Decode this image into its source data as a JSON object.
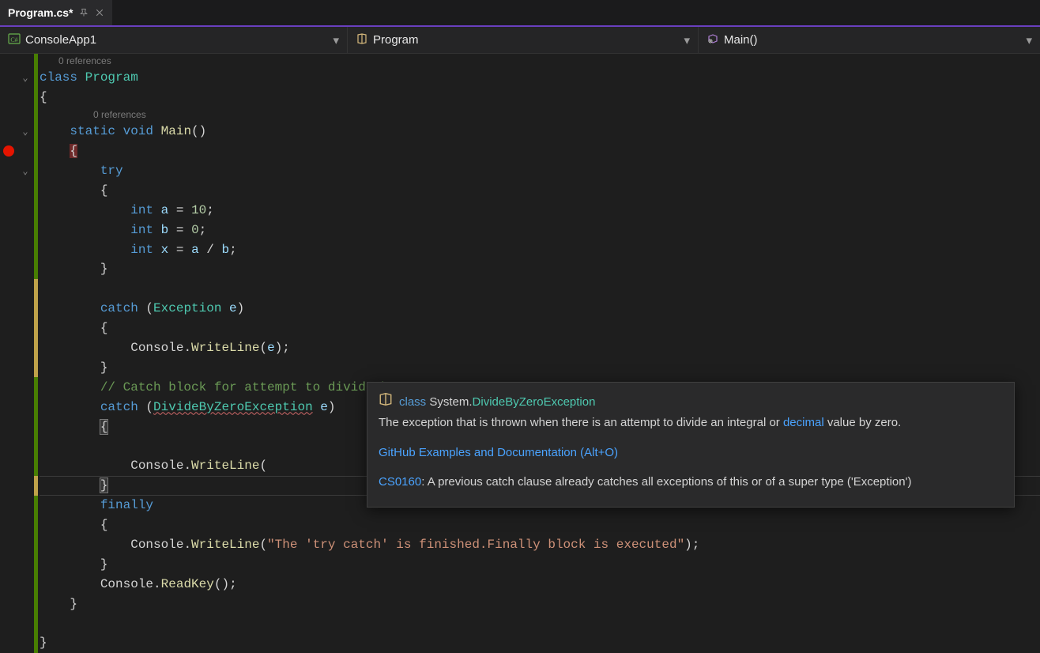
{
  "tab": {
    "label": "Program.cs*"
  },
  "nav": {
    "project": "ConsoleApp1",
    "class": "Program",
    "member": "Main()"
  },
  "codelens": {
    "class_refs": "0 references",
    "main_refs": "0 references"
  },
  "code": {
    "l01_class": "class",
    "l01_name": "Program",
    "l02": "{",
    "l03_static": "static",
    "l03_void": "void",
    "l03_main": "Main",
    "l03_parens": "()",
    "l04": "{",
    "l05_try": "try",
    "l06": "{",
    "l07_int": "int",
    "l07_a": "a",
    "l07_eq": " = ",
    "l07_val": "10",
    "l07_semi": ";",
    "l08_int": "int",
    "l08_b": "b",
    "l08_eq": " = ",
    "l08_val": "0",
    "l08_semi": ";",
    "l09_int": "int",
    "l09_x": "x",
    "l09_eq": " = ",
    "l09_expr_a": "a",
    "l09_expr_op": " / ",
    "l09_expr_b": "b",
    "l09_semi": ";",
    "l10": "}",
    "l12_catch": "catch",
    "l12_paren_o": " (",
    "l12_type": "Exception",
    "l12_var": " e",
    "l12_paren_c": ")",
    "l13": "{",
    "l14_console": "Console",
    "l14_dot": ".",
    "l14_method": "WriteLine",
    "l14_args_o": "(",
    "l14_arg": "e",
    "l14_args_c": ");",
    "l15": "}",
    "l16_comment": "// Catch block for attempt to divide by zero",
    "l17_catch": "catch",
    "l17_paren_o": " (",
    "l17_type": "DivideByZeroException",
    "l17_var": " e",
    "l17_paren_c": ")",
    "l18": "{",
    "l20_console": "Console",
    "l20_dot": ".",
    "l20_method": "WriteLine",
    "l20_args": "(",
    "l21": "}",
    "l22_finally": "finally",
    "l23": "{",
    "l24_console": "Console",
    "l24_dot": ".",
    "l24_method": "WriteLine",
    "l24_args_o": "(",
    "l24_str": "\"The 'try catch' is finished.Finally block is executed\"",
    "l24_args_c": ");",
    "l25": "}",
    "l26_console": "Console",
    "l26_dot": ".",
    "l26_method": "ReadKey",
    "l26_args": "();",
    "l27": "}",
    "l29": "}"
  },
  "tooltip": {
    "kind": "class",
    "ns": "System.",
    "type": "DivideByZeroException",
    "desc_pre": "The exception that is thrown when there is an attempt to divide an integral or ",
    "desc_link": "decimal",
    "desc_post": " value by zero.",
    "gh_link": "GitHub Examples and Documentation (Alt+O)",
    "diag_code": "CS0160",
    "diag_msg": ": A previous catch clause already catches all exceptions of this or of a super type ('Exception')"
  }
}
